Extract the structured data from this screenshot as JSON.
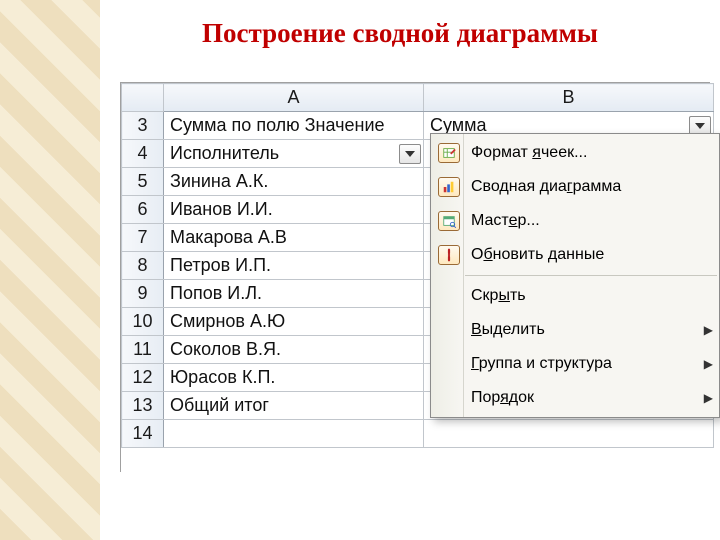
{
  "title": "Построение сводной диаграммы",
  "columns": {
    "A": "A",
    "B": "B"
  },
  "row_numbers": [
    "3",
    "4",
    "5",
    "6",
    "7",
    "8",
    "9",
    "10",
    "11",
    "12",
    "13",
    "14"
  ],
  "cells_A": [
    "Сумма по полю Значение",
    "Исполнитель",
    "Зинина А.К.",
    "Иванов И.И.",
    "Макарова А.В",
    "Петров И.П.",
    "Попов И.Л.",
    "Смирнов А.Ю",
    "Соколов В.Я.",
    "Юрасов К.П.",
    "Общий итог",
    ""
  ],
  "cells_B_first": "Сумма",
  "menu": {
    "items": [
      {
        "icon": "format-cells-icon",
        "label_parts": [
          "Формат ",
          "я",
          "чеек..."
        ],
        "mnemonic_index": 1
      },
      {
        "icon": "pivot-chart-icon",
        "label_parts": [
          "Сводная диа",
          "г",
          "рамма"
        ],
        "mnemonic_index": 1
      },
      {
        "icon": "wizard-icon",
        "label_parts": [
          "Маст",
          "е",
          "р..."
        ],
        "mnemonic_index": 1
      },
      {
        "icon": "refresh-icon",
        "label_parts": [
          "О",
          "б",
          "новить данные"
        ],
        "mnemonic_index": 1
      },
      {
        "sep": true
      },
      {
        "label_parts": [
          "Скр",
          "ы",
          "ть"
        ],
        "mnemonic_index": 1
      },
      {
        "label_parts": [
          "",
          "В",
          "ыделить"
        ],
        "mnemonic_index": 1,
        "has_sub": true
      },
      {
        "label_parts": [
          "",
          "Г",
          "руппа и структура"
        ],
        "mnemonic_index": 1,
        "has_sub": true
      },
      {
        "label_parts": [
          "Пор",
          "я",
          "док"
        ],
        "mnemonic_index": 1,
        "has_sub": true
      }
    ]
  }
}
